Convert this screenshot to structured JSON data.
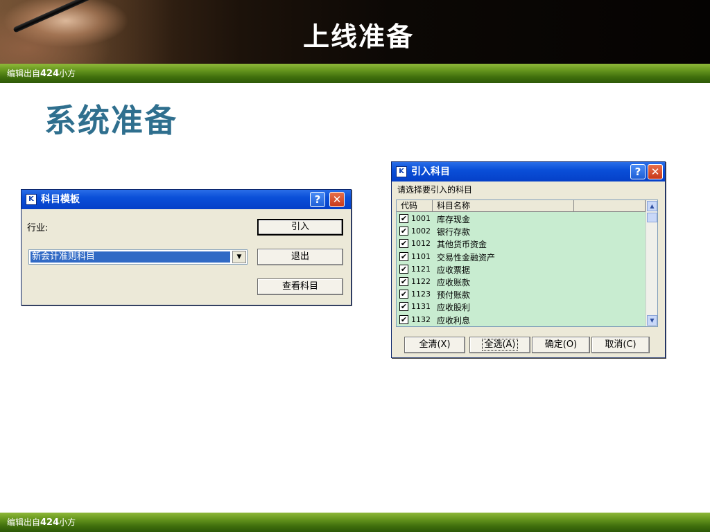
{
  "slide": {
    "title": "上线准备",
    "footer_prefix": "编辑出自",
    "footer_bold": "424",
    "footer_suffix": "小方",
    "heading": "系统准备"
  },
  "template_dialog": {
    "title": "科目模板",
    "app_icon": "K",
    "industry_label": "行业:",
    "industry_value": "新会计准则科目",
    "buttons": {
      "import": "引入",
      "exit": "退出",
      "view": "查看科目"
    }
  },
  "import_dialog": {
    "title": "引入科目",
    "app_icon": "K",
    "prompt": "请选择要引入的科目",
    "columns": [
      "代码",
      "科目名称",
      ""
    ],
    "rows": [
      {
        "code": "1001",
        "name": "库存现金",
        "checked": true
      },
      {
        "code": "1002",
        "name": "银行存款",
        "checked": true
      },
      {
        "code": "1012",
        "name": "其他货币资金",
        "checked": true
      },
      {
        "code": "1101",
        "name": "交易性金融资产",
        "checked": true
      },
      {
        "code": "1121",
        "name": "应收票据",
        "checked": true
      },
      {
        "code": "1122",
        "name": "应收账款",
        "checked": true
      },
      {
        "code": "1123",
        "name": "预付账款",
        "checked": true
      },
      {
        "code": "1131",
        "name": "应收股利",
        "checked": true
      },
      {
        "code": "1132",
        "name": "应收利息",
        "checked": true
      }
    ],
    "buttons": {
      "clear_all": "全清(X)",
      "select_all": "全选(A)",
      "ok": "确定(O)",
      "cancel": "取消(C)"
    }
  },
  "titlebar_buttons": {
    "help": "?",
    "close": "✕"
  },
  "icons": {
    "check": "✔",
    "dropdown": "▼",
    "scroll_up": "▲",
    "scroll_down": "▼"
  }
}
